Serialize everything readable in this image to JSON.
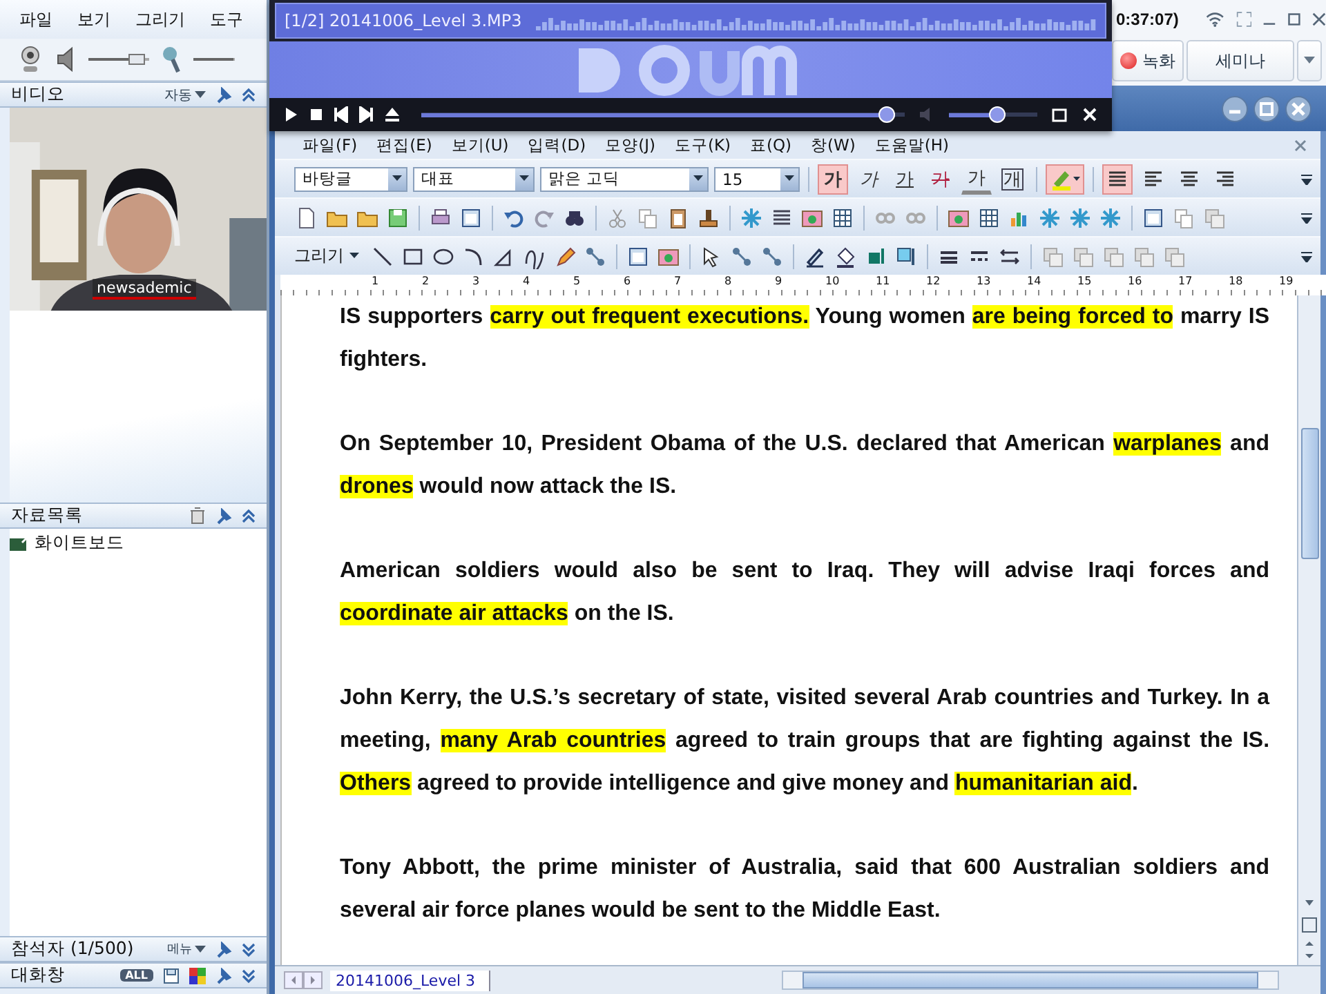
{
  "app_menu": [
    "파일",
    "보기",
    "그리기",
    "도구"
  ],
  "clock": "0:37:07)",
  "record_button": "녹화",
  "mode_button": "세미나",
  "media_bar": {
    "speaker": {
      "level": 0.9
    },
    "microphone": {
      "level": 0.95
    }
  },
  "video_panel": {
    "title": "비디오",
    "mode": "자동",
    "caption": "newsademic"
  },
  "materials_panel": {
    "title": "자료목록",
    "items": [
      "화이트보드"
    ]
  },
  "attendees_panel": {
    "title": "참석자 (1/500)",
    "menu": "메뉴"
  },
  "chat_panel": {
    "title": "대화창",
    "filter": "ALL"
  },
  "player": {
    "title": "[1/2] 20141006_Level 3.MP3",
    "progress": {
      "level": 0.98
    },
    "volume": {
      "level": 0.55
    }
  },
  "editor": {
    "menu": [
      "파일(F)",
      "편집(E)",
      "보기(U)",
      "입력(D)",
      "모양(J)",
      "도구(K)",
      "표(Q)",
      "창(W)",
      "도움말(H)"
    ],
    "style": "바탕글",
    "language": "대표",
    "font": "맑은 고딕",
    "size": "15",
    "format_buttons": [
      {
        "label": "가",
        "kind": "bold",
        "selected": true
      },
      {
        "label": "가",
        "kind": "italic",
        "selected": false
      },
      {
        "label": "가",
        "kind": "underline",
        "selected": false
      },
      {
        "label": "가",
        "kind": "strike",
        "selected": false
      },
      {
        "label": "가",
        "kind": "color",
        "selected": false
      },
      {
        "label": "개",
        "kind": "boxed",
        "selected": false
      }
    ],
    "highlight_button": {
      "selected": true
    },
    "align_buttons": [
      {
        "selected": true
      },
      {
        "selected": false
      },
      {
        "selected": false
      },
      {
        "selected": false
      }
    ],
    "draw_menu": "그리기",
    "ruler": [
      "1",
      "2",
      "3",
      "4",
      "5",
      "6",
      "7",
      "8",
      "9",
      "10",
      "11",
      "12",
      "13",
      "14",
      "15",
      "16",
      "17",
      "18",
      "19"
    ],
    "paragraphs": [
      {
        "segments": [
          {
            "text": "IS supporters ",
            "highlight": false
          },
          {
            "text": "carry out frequent executions.",
            "highlight": true
          },
          {
            "text": " Young women ",
            "highlight": false
          },
          {
            "text": "are being forced to",
            "highlight": true
          },
          {
            "text": " marry IS fighters.",
            "highlight": false
          }
        ]
      },
      {
        "segments": [
          {
            "text": "On September 10, President Obama of the U.S. declared that American ",
            "highlight": false
          },
          {
            "text": "warplanes",
            "highlight": true
          },
          {
            "text": " and ",
            "highlight": false
          },
          {
            "text": "drones",
            "highlight": true
          },
          {
            "text": " would now attack the IS.",
            "highlight": false
          }
        ]
      },
      {
        "segments": [
          {
            "text": "American soldiers would also be sent to Iraq. They will advise Iraqi forces and ",
            "highlight": false
          },
          {
            "text": "coordinate air attacks",
            "highlight": true
          },
          {
            "text": " on the IS.",
            "highlight": false
          }
        ]
      },
      {
        "segments": [
          {
            "text": "John Kerry, the U.S.’s secretary of state, visited several Arab countries and Turkey. In a meeting, ",
            "highlight": false
          },
          {
            "text": "many Arab countries",
            "highlight": true
          },
          {
            "text": " agreed to train groups that are fighting against the IS. ",
            "highlight": false
          },
          {
            "text": "Others",
            "highlight": true
          },
          {
            "text": " agreed to provide intelligence and give money and ",
            "highlight": false
          },
          {
            "text": "humanitarian aid",
            "highlight": true
          },
          {
            "text": ".",
            "highlight": false
          }
        ]
      },
      {
        "segments": [
          {
            "text": "Tony Abbott, the prime minister of Australia, said that 600 Australian soldiers and several air force planes would be sent to the Middle East.",
            "highlight": false
          }
        ]
      }
    ],
    "tabs": [
      {
        "label": "20141006_Level 3",
        "selected": true
      }
    ]
  }
}
